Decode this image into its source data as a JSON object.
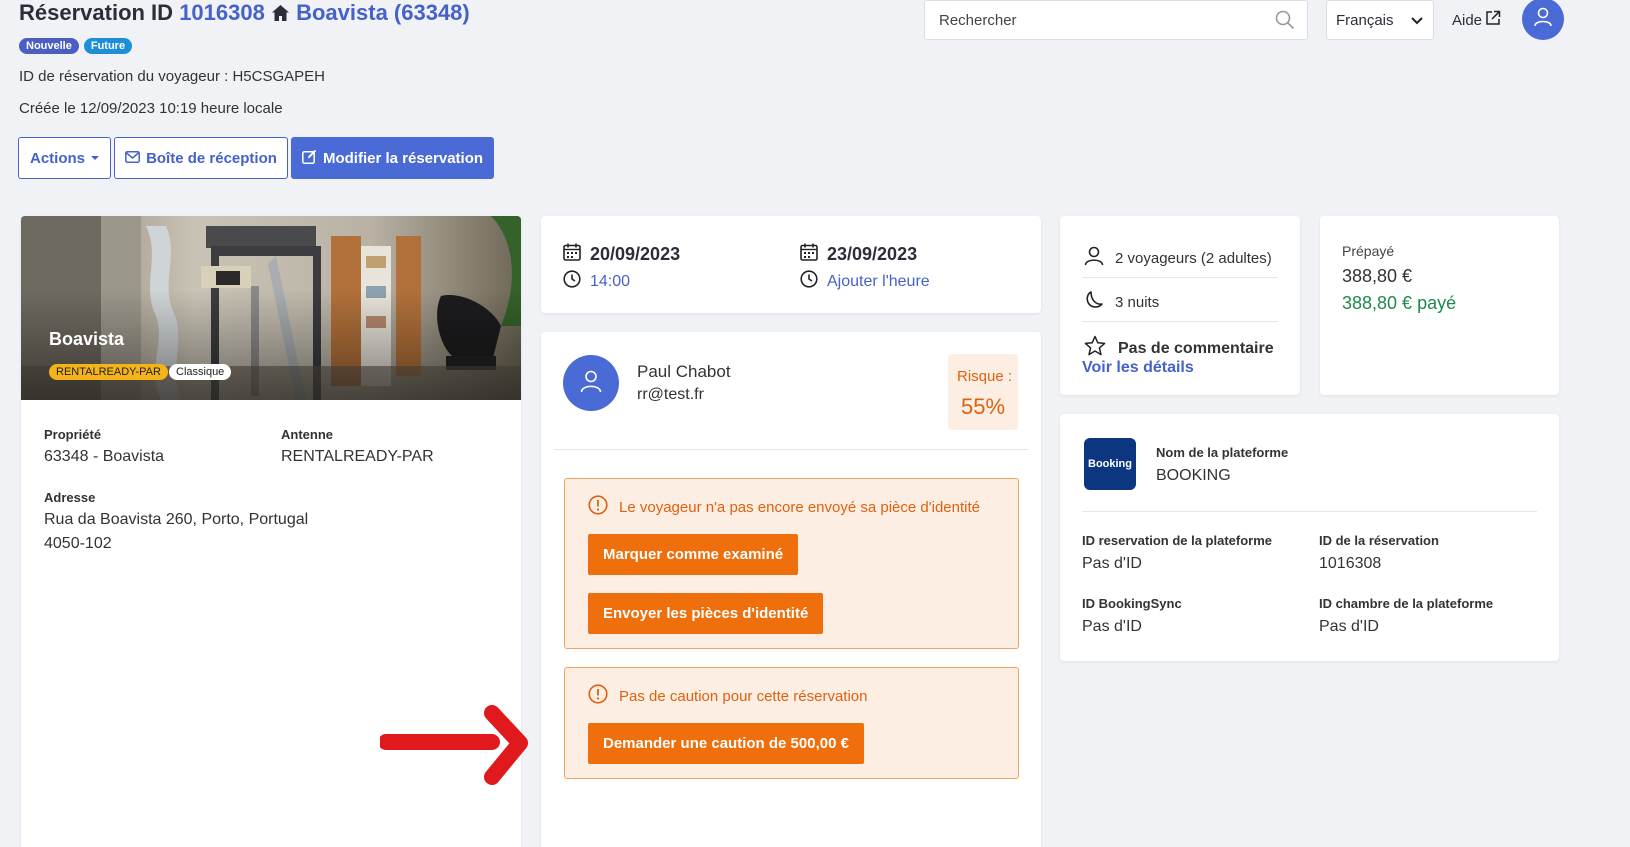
{
  "header": {
    "title_prefix": "Réservation ID",
    "reservation_id": "1016308",
    "property_link": "Boavista (63348)",
    "badges": [
      "Nouvelle",
      "Future"
    ],
    "guest_reservation_id": "ID de réservation du voyageur : H5CSGAPEH",
    "created": "Créée le 12/09/2023 10:19 heure locale",
    "buttons": {
      "actions": "Actions",
      "inbox": "Boîte de réception",
      "edit": "Modifier la réservation"
    }
  },
  "topbar": {
    "search_placeholder": "Rechercher",
    "language": "Français",
    "help": "Aide"
  },
  "property": {
    "name": "Boavista",
    "tags": [
      "RENTALREADY-PAR",
      "Classique"
    ],
    "property_label": "Propriété",
    "property_value": "63348 - Boavista",
    "branch_label": "Antenne",
    "branch_value": "RENTALREADY-PAR",
    "address_label": "Adresse",
    "address_line1": "Rua da Boavista 260, Porto, Portugal",
    "address_line2": "4050-102"
  },
  "dates": {
    "checkin_date": "20/09/2023",
    "checkin_time": "14:00",
    "checkout_date": "23/09/2023",
    "checkout_time": "Ajouter l'heure"
  },
  "guest": {
    "name": "Paul Chabot",
    "email": "rr@test.fr",
    "risk_label": "Risque :",
    "risk_value": "55%",
    "id_warning": "Le voyageur n'a pas encore envoyé sa pièce d'identité",
    "btn_mark_reviewed": "Marquer comme examiné",
    "btn_send_ids": "Envoyer les pièces d'identité",
    "deposit_warning": "Pas de caution pour cette réservation",
    "btn_request_deposit": "Demander une caution de 500,00 €"
  },
  "stay": {
    "guests": "2 voyageurs (2 adultes)",
    "nights": "3 nuits",
    "comment": "Pas de commentaire",
    "details_link": "Voir les détails"
  },
  "payment": {
    "label": "Prépayé",
    "amount": "388,80 €",
    "paid": "388,80 € payé"
  },
  "platform": {
    "logo_text": "Booking",
    "name_label": "Nom de la plateforme",
    "name_value": "BOOKING",
    "platform_res_id_label": "ID reservation de la plateforme",
    "platform_res_id_value": "Pas d'ID",
    "res_id_label": "ID de la réservation",
    "res_id_value": "1016308",
    "bookingsync_label": "ID BookingSync",
    "bookingsync_value": "Pas d'ID",
    "room_id_label": "ID chambre de la plateforme",
    "room_id_value": "Pas d'ID"
  },
  "colors": {
    "primary": "#4a6bd6",
    "orange": "#ee6f0b",
    "green": "#1f8a4c",
    "annotation_arrow": "#e0191c"
  }
}
